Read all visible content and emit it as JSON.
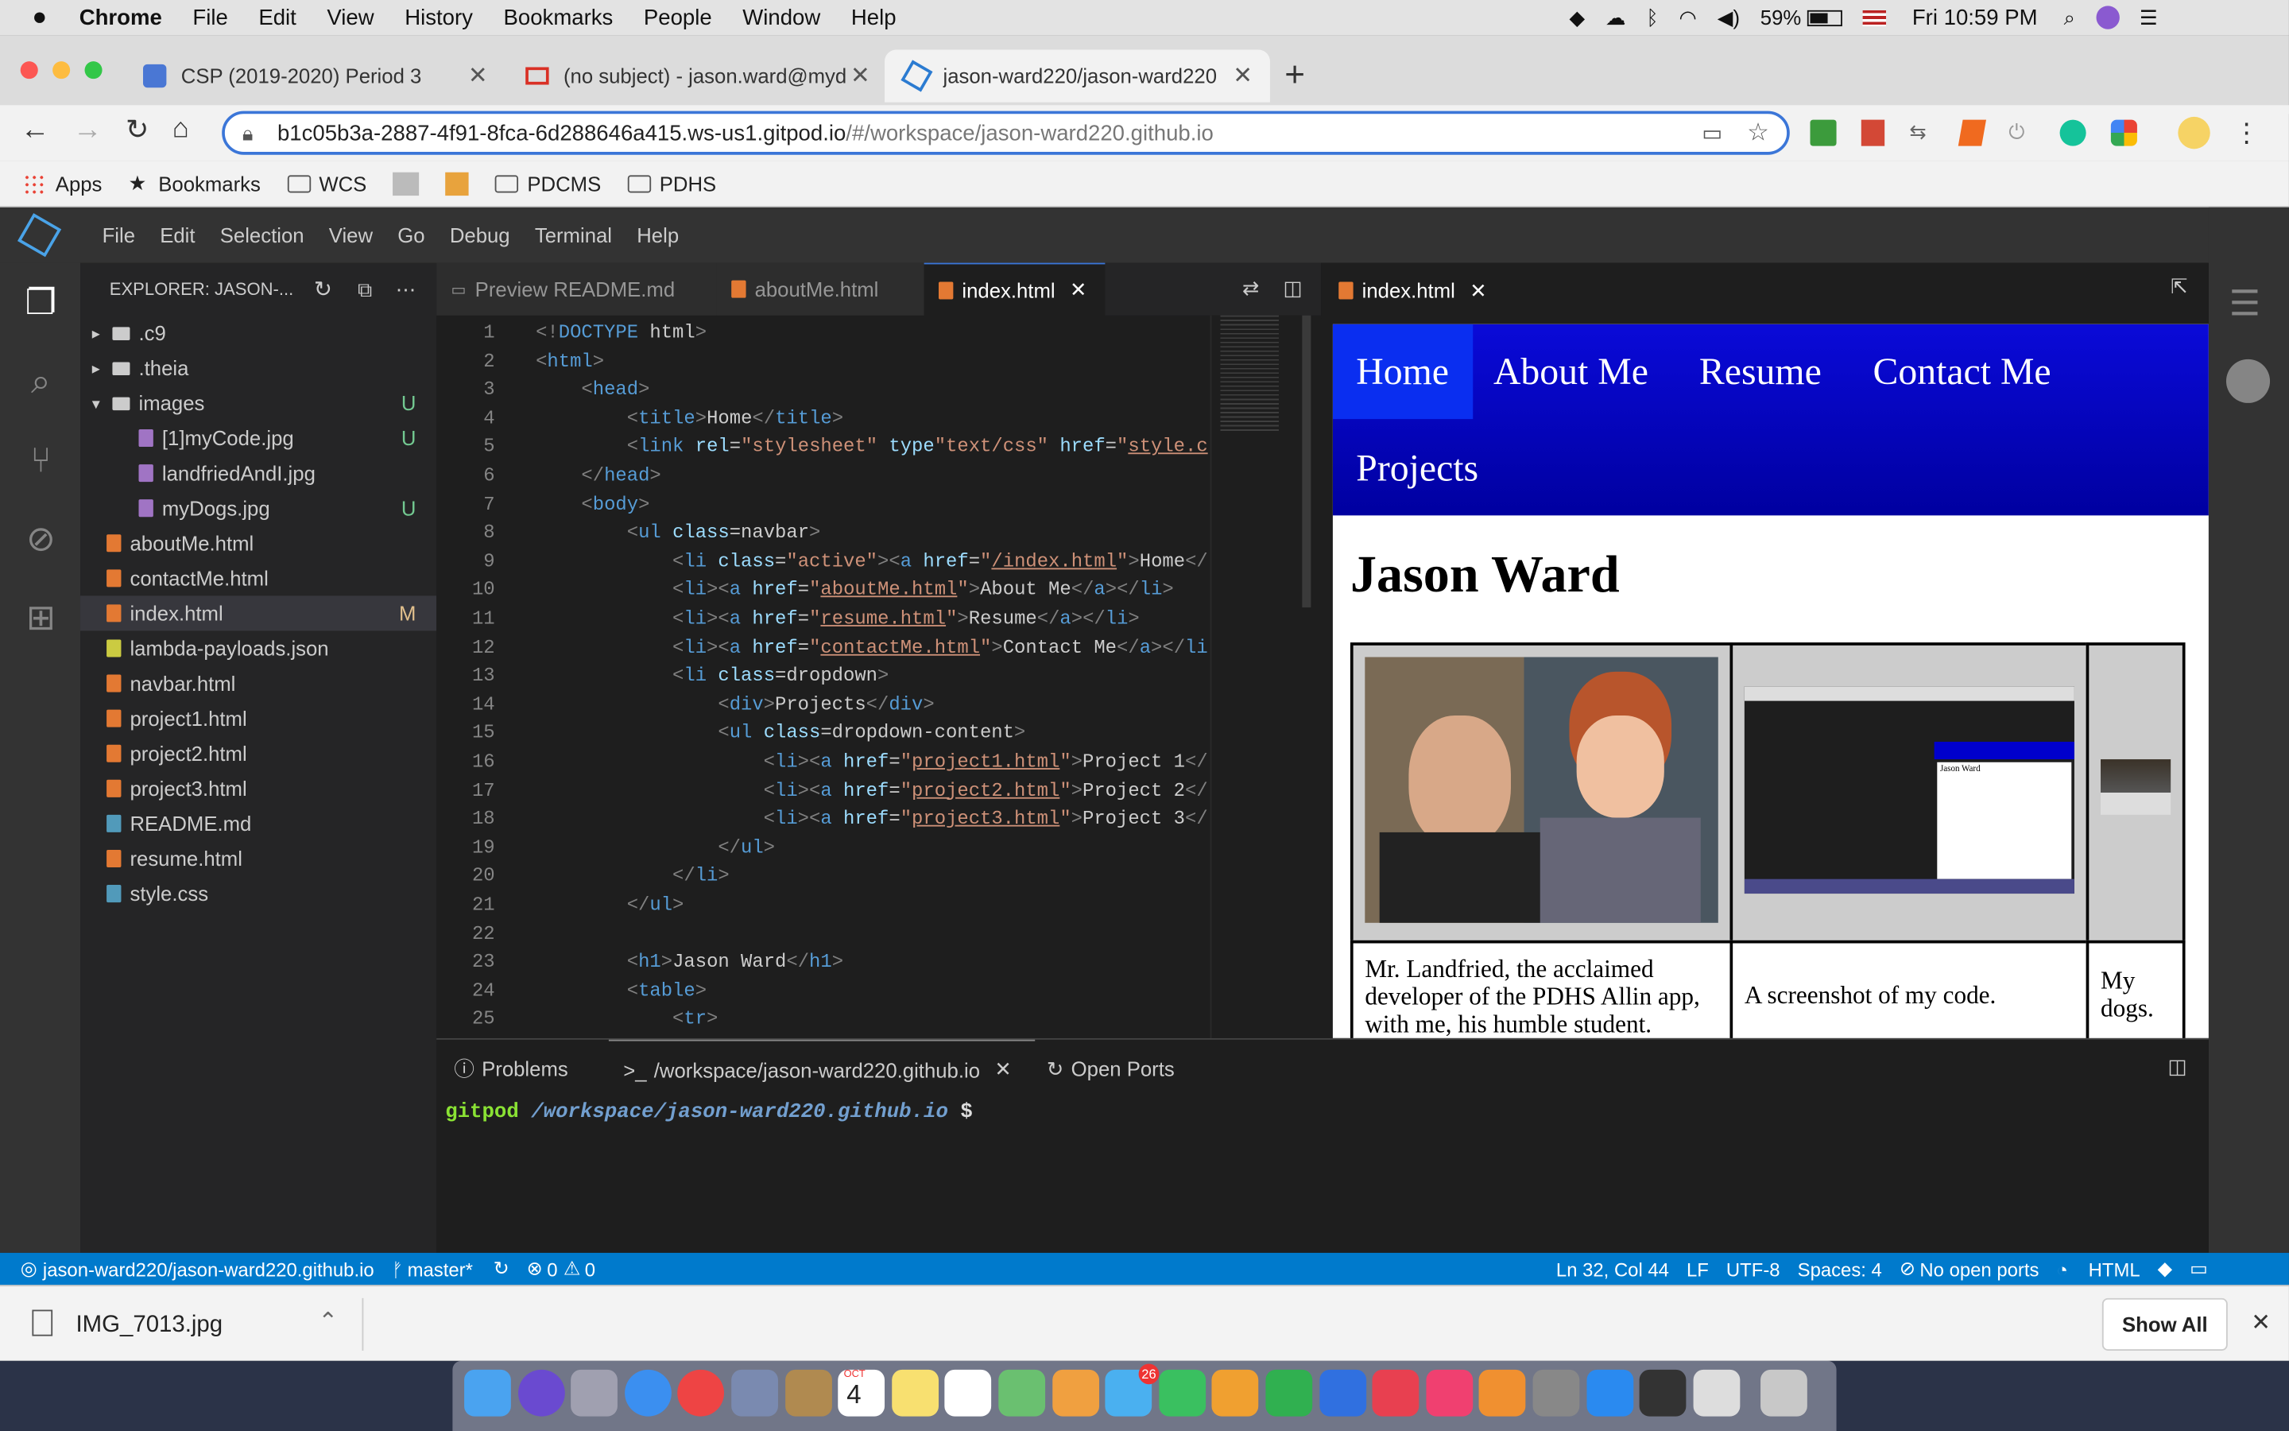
{
  "mac_menubar": {
    "apple": "",
    "app_name": "Chrome",
    "menus": [
      "File",
      "Edit",
      "View",
      "History",
      "Bookmarks",
      "People",
      "Window",
      "Help"
    ],
    "battery": "59%",
    "clock": "Fri 10:59 PM"
  },
  "chrome": {
    "tabs": [
      {
        "title": "CSP (2019-2020) Period 3",
        "icon": "classroom-icon",
        "color": "#4a77d4"
      },
      {
        "title": "(no subject) - jason.ward@myd",
        "icon": "gmail-icon",
        "color": "#d93025"
      },
      {
        "title": "jason-ward220/jason-ward220",
        "icon": "gitpod-icon",
        "color": "#2b7bd1"
      }
    ],
    "new_tab": "+",
    "url_host": "b1c05b3a-2887-4f91-8fca-6d288646a415.ws-us1.gitpod.io",
    "url_path": "/#/workspace/jason-ward220.github.io",
    "bookmarks": [
      {
        "label": "Apps",
        "icon": "apps-grid-icon"
      },
      {
        "label": "Bookmarks",
        "icon": "star-icon"
      },
      {
        "label": "WCS",
        "icon": "folder-icon"
      },
      {
        "label": "",
        "icon": "rl-logo-icon"
      },
      {
        "label": "",
        "icon": "bookmark-image-icon"
      },
      {
        "label": "PDCMS",
        "icon": "folder-icon"
      },
      {
        "label": "PDHS",
        "icon": "folder-icon"
      }
    ]
  },
  "ide": {
    "menus": [
      "File",
      "Edit",
      "Selection",
      "View",
      "Go",
      "Debug",
      "Terminal",
      "Help"
    ],
    "explorer_title": "EXPLORER: JASON-...",
    "tree": [
      {
        "label": ".c9",
        "type": "folder",
        "depth": 0,
        "open": false,
        "badge": ""
      },
      {
        "label": ".theia",
        "type": "folder",
        "depth": 0,
        "open": false,
        "badge": ""
      },
      {
        "label": "images",
        "type": "folder",
        "depth": 0,
        "open": true,
        "badge": "U"
      },
      {
        "label": "[1]myCode.jpg",
        "type": "image",
        "depth": 1,
        "badge": "U"
      },
      {
        "label": "landfriedAndI.jpg",
        "type": "image",
        "depth": 1,
        "badge": ""
      },
      {
        "label": "myDogs.jpg",
        "type": "image",
        "depth": 1,
        "badge": "U"
      },
      {
        "label": "aboutMe.html",
        "type": "html",
        "depth": 0,
        "badge": ""
      },
      {
        "label": "contactMe.html",
        "type": "html",
        "depth": 0,
        "badge": ""
      },
      {
        "label": "index.html",
        "type": "html",
        "depth": 0,
        "badge": "M",
        "selected": true
      },
      {
        "label": "lambda-payloads.json",
        "type": "json",
        "depth": 0,
        "badge": ""
      },
      {
        "label": "navbar.html",
        "type": "html",
        "depth": 0,
        "badge": ""
      },
      {
        "label": "project1.html",
        "type": "html",
        "depth": 0,
        "badge": ""
      },
      {
        "label": "project2.html",
        "type": "html",
        "depth": 0,
        "badge": ""
      },
      {
        "label": "project3.html",
        "type": "html",
        "depth": 0,
        "badge": ""
      },
      {
        "label": "README.md",
        "type": "md",
        "depth": 0,
        "badge": ""
      },
      {
        "label": "resume.html",
        "type": "html",
        "depth": 0,
        "badge": ""
      },
      {
        "label": "style.css",
        "type": "css",
        "depth": 0,
        "badge": ""
      }
    ],
    "editor_tabs": [
      {
        "label": "Preview README.md",
        "active": false
      },
      {
        "label": "aboutMe.html",
        "active": false
      },
      {
        "label": "index.html",
        "active": true
      }
    ],
    "code_lines": [
      [
        [
          "p",
          "<!"
        ],
        [
          "t",
          "DOCTYPE"
        ],
        [
          "c",
          " html"
        ],
        [
          "p",
          ">"
        ]
      ],
      [
        [
          "p",
          "<"
        ],
        [
          "t",
          "html"
        ],
        [
          "p",
          ">"
        ]
      ],
      [
        [
          "c",
          "    "
        ],
        [
          "p",
          "<"
        ],
        [
          "t",
          "head"
        ],
        [
          "p",
          ">"
        ]
      ],
      [
        [
          "c",
          "        "
        ],
        [
          "p",
          "<"
        ],
        [
          "t",
          "title"
        ],
        [
          "p",
          ">"
        ],
        [
          "c",
          "Home"
        ],
        [
          "p",
          "</"
        ],
        [
          "t",
          "title"
        ],
        [
          "p",
          ">"
        ]
      ],
      [
        [
          "c",
          "        "
        ],
        [
          "p",
          "<"
        ],
        [
          "t",
          "link"
        ],
        [
          "a",
          " rel"
        ],
        [
          "c",
          "="
        ],
        [
          "s",
          "\"stylesheet\""
        ],
        [
          "a",
          " type"
        ],
        [
          "s",
          "\"text/css\""
        ],
        [
          "a",
          " href"
        ],
        [
          "c",
          "="
        ],
        [
          "s",
          "\""
        ],
        [
          "u",
          "style.c"
        ]
      ],
      [
        [
          "c",
          "    "
        ],
        [
          "p",
          "</"
        ],
        [
          "t",
          "head"
        ],
        [
          "p",
          ">"
        ]
      ],
      [
        [
          "c",
          "    "
        ],
        [
          "p",
          "<"
        ],
        [
          "t",
          "body"
        ],
        [
          "p",
          ">"
        ]
      ],
      [
        [
          "c",
          "        "
        ],
        [
          "p",
          "<"
        ],
        [
          "t",
          "ul"
        ],
        [
          "a",
          " class"
        ],
        [
          "c",
          "=navbar"
        ],
        [
          "p",
          ">"
        ]
      ],
      [
        [
          "c",
          "            "
        ],
        [
          "p",
          "<"
        ],
        [
          "t",
          "li"
        ],
        [
          "a",
          " class"
        ],
        [
          "c",
          "="
        ],
        [
          "s",
          "\"active\""
        ],
        [
          "p",
          "><"
        ],
        [
          "t",
          "a"
        ],
        [
          "a",
          " href"
        ],
        [
          "c",
          "="
        ],
        [
          "s",
          "\""
        ],
        [
          "u",
          "/index.html"
        ],
        [
          "s",
          "\""
        ],
        [
          "p",
          ">"
        ],
        [
          "c",
          "Home"
        ],
        [
          "p",
          "</"
        ]
      ],
      [
        [
          "c",
          "            "
        ],
        [
          "p",
          "<"
        ],
        [
          "t",
          "li"
        ],
        [
          "p",
          "><"
        ],
        [
          "t",
          "a"
        ],
        [
          "a",
          " href"
        ],
        [
          "c",
          "="
        ],
        [
          "s",
          "\""
        ],
        [
          "u",
          "aboutMe.html"
        ],
        [
          "s",
          "\""
        ],
        [
          "p",
          ">"
        ],
        [
          "c",
          "About Me"
        ],
        [
          "p",
          "</"
        ],
        [
          "t",
          "a"
        ],
        [
          "p",
          "></"
        ],
        [
          "t",
          "li"
        ],
        [
          "p",
          ">"
        ]
      ],
      [
        [
          "c",
          "            "
        ],
        [
          "p",
          "<"
        ],
        [
          "t",
          "li"
        ],
        [
          "p",
          "><"
        ],
        [
          "t",
          "a"
        ],
        [
          "a",
          " href"
        ],
        [
          "c",
          "="
        ],
        [
          "s",
          "\""
        ],
        [
          "u",
          "resume.html"
        ],
        [
          "s",
          "\""
        ],
        [
          "p",
          ">"
        ],
        [
          "c",
          "Resume"
        ],
        [
          "p",
          "</"
        ],
        [
          "t",
          "a"
        ],
        [
          "p",
          "></"
        ],
        [
          "t",
          "li"
        ],
        [
          "p",
          ">"
        ]
      ],
      [
        [
          "c",
          "            "
        ],
        [
          "p",
          "<"
        ],
        [
          "t",
          "li"
        ],
        [
          "p",
          "><"
        ],
        [
          "t",
          "a"
        ],
        [
          "a",
          " href"
        ],
        [
          "c",
          "="
        ],
        [
          "s",
          "\""
        ],
        [
          "u",
          "contactMe.html"
        ],
        [
          "s",
          "\""
        ],
        [
          "p",
          ">"
        ],
        [
          "c",
          "Contact Me"
        ],
        [
          "p",
          "</"
        ],
        [
          "t",
          "a"
        ],
        [
          "p",
          "></"
        ],
        [
          "t",
          "li"
        ]
      ],
      [
        [
          "c",
          "            "
        ],
        [
          "p",
          "<"
        ],
        [
          "t",
          "li"
        ],
        [
          "a",
          " class"
        ],
        [
          "c",
          "=dropdown"
        ],
        [
          "p",
          ">"
        ]
      ],
      [
        [
          "c",
          "                "
        ],
        [
          "p",
          "<"
        ],
        [
          "t",
          "div"
        ],
        [
          "p",
          ">"
        ],
        [
          "c",
          "Projects"
        ],
        [
          "p",
          "</"
        ],
        [
          "t",
          "div"
        ],
        [
          "p",
          ">"
        ]
      ],
      [
        [
          "c",
          "                "
        ],
        [
          "p",
          "<"
        ],
        [
          "t",
          "ul"
        ],
        [
          "a",
          " class"
        ],
        [
          "c",
          "=dropdown-content"
        ],
        [
          "p",
          ">"
        ]
      ],
      [
        [
          "c",
          "                    "
        ],
        [
          "p",
          "<"
        ],
        [
          "t",
          "li"
        ],
        [
          "p",
          "><"
        ],
        [
          "t",
          "a"
        ],
        [
          "a",
          " href"
        ],
        [
          "c",
          "="
        ],
        [
          "s",
          "\""
        ],
        [
          "u",
          "project1.html"
        ],
        [
          "s",
          "\""
        ],
        [
          "p",
          ">"
        ],
        [
          "c",
          "Project 1"
        ],
        [
          "p",
          "</"
        ]
      ],
      [
        [
          "c",
          "                    "
        ],
        [
          "p",
          "<"
        ],
        [
          "t",
          "li"
        ],
        [
          "p",
          "><"
        ],
        [
          "t",
          "a"
        ],
        [
          "a",
          " href"
        ],
        [
          "c",
          "="
        ],
        [
          "s",
          "\""
        ],
        [
          "u",
          "project2.html"
        ],
        [
          "s",
          "\""
        ],
        [
          "p",
          ">"
        ],
        [
          "c",
          "Project 2"
        ],
        [
          "p",
          "</"
        ]
      ],
      [
        [
          "c",
          "                    "
        ],
        [
          "p",
          "<"
        ],
        [
          "t",
          "li"
        ],
        [
          "p",
          "><"
        ],
        [
          "t",
          "a"
        ],
        [
          "a",
          " href"
        ],
        [
          "c",
          "="
        ],
        [
          "s",
          "\""
        ],
        [
          "u",
          "project3.html"
        ],
        [
          "s",
          "\""
        ],
        [
          "p",
          ">"
        ],
        [
          "c",
          "Project 3"
        ],
        [
          "p",
          "</"
        ]
      ],
      [
        [
          "c",
          "                "
        ],
        [
          "p",
          "</"
        ],
        [
          "t",
          "ul"
        ],
        [
          "p",
          ">"
        ]
      ],
      [
        [
          "c",
          "            "
        ],
        [
          "p",
          "</"
        ],
        [
          "t",
          "li"
        ],
        [
          "p",
          ">"
        ]
      ],
      [
        [
          "c",
          "        "
        ],
        [
          "p",
          "</"
        ],
        [
          "t",
          "ul"
        ],
        [
          "p",
          ">"
        ]
      ],
      [],
      [
        [
          "c",
          "        "
        ],
        [
          "p",
          "<"
        ],
        [
          "t",
          "h1"
        ],
        [
          "p",
          ">"
        ],
        [
          "c",
          "Jason Ward"
        ],
        [
          "p",
          "</"
        ],
        [
          "t",
          "h1"
        ],
        [
          "p",
          ">"
        ]
      ],
      [
        [
          "c",
          "        "
        ],
        [
          "p",
          "<"
        ],
        [
          "t",
          "table"
        ],
        [
          "p",
          ">"
        ]
      ],
      [
        [
          "c",
          "            "
        ],
        [
          "p",
          "<"
        ],
        [
          "t",
          "tr"
        ],
        [
          "p",
          ">"
        ]
      ]
    ],
    "preview": {
      "tab": "index.html",
      "nav": [
        "Home",
        "About Me",
        "Resume",
        "Contact Me",
        "Projects"
      ],
      "heading": "Jason Ward",
      "captions": [
        "Mr. Landfried, the acclaimed developer of the PDHS Allin app, with me, his humble student.",
        "A screenshot of my code.",
        "My dogs."
      ],
      "mini_page_title": "Jason Ward"
    },
    "panel": {
      "tabs": [
        "Problems",
        "/workspace/jason-ward220.github.io",
        "Open Ports"
      ],
      "prompt_user": "gitpod",
      "prompt_path": "/workspace/jason-ward220.github.io",
      "prompt_symbol": "$"
    },
    "status": {
      "repo": "jason-ward220/jason-ward220.github.io",
      "branch": "master*",
      "errors": "0",
      "warnings": "0",
      "position": "Ln 32, Col 44",
      "eol": "LF",
      "encoding": "UTF-8",
      "spaces": "Spaces: 4",
      "ports": "No open ports",
      "language": "HTML"
    }
  },
  "download_bar": {
    "file": "IMG_7013.jpg",
    "show_all": "Show All",
    "close": "✕"
  },
  "dock": {
    "calendar_month": "OCT",
    "calendar_day": "4",
    "messages_badge": "26"
  },
  "colors": {
    "accent": "#007acc",
    "nav_blue": "#0000c8",
    "untracked": "#73c991",
    "modified": "#e2c08d"
  }
}
